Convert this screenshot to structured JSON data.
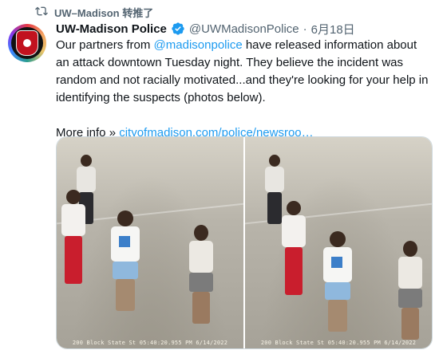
{
  "retweet": {
    "label": "UW–Madison 转推了"
  },
  "tweet": {
    "author_name": "UW-Madison Police",
    "handle": "@UWMadisonPolice",
    "separator": "·",
    "date": "6月18日",
    "text_part1": "Our partners from ",
    "mention": "@madisonpolice",
    "text_part2": " have released information about an attack downtown Tuesday night. They believe the incident was random and not racially motivated...and they're looking for your help in identifying the suspects (photos below).",
    "more_info_label": "More info »",
    "link_text": "cityofmadison.com/police/newsroo…"
  },
  "media": {
    "photos": [
      {
        "caption": "200 Block State St 05:40:20.955 PM 6/14/2022"
      },
      {
        "caption": "200 Block State St 05:40:20.955 PM 6/14/2022"
      }
    ]
  },
  "colors": {
    "link": "#1d9bf0",
    "verified": "#1d9bf0",
    "muted": "#536471"
  },
  "icons": {
    "retweet": "retweet-icon",
    "verified": "verified-badge-icon",
    "avatar": "police-badge-avatar"
  }
}
